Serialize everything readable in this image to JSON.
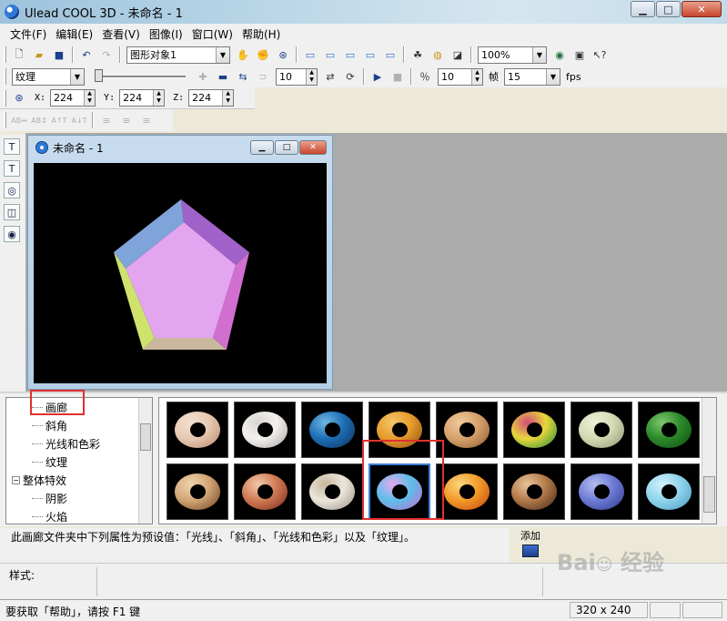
{
  "window": {
    "title": "Ulead COOL 3D - 未命名 - 1"
  },
  "menu": [
    "文件(F)",
    "编辑(E)",
    "查看(V)",
    "图像(I)",
    "窗口(W)",
    "帮助(H)"
  ],
  "toolbar1": {
    "object_combo": "图形对象1",
    "zoom_combo": "100%"
  },
  "toolbar2": {
    "attr_combo": "纹理",
    "spin1": "10",
    "spin2": "10",
    "fps_combo": "15",
    "frame_label": "帧",
    "fps_label": "fps"
  },
  "toolbar3": {
    "x_label": "X:",
    "x_value": "224",
    "y_label": "Y:",
    "y_value": "224",
    "z_label": "Z:",
    "z_value": "224"
  },
  "toolbar4": {
    "icons": [
      "AB↔",
      "AB↕",
      "A↑T",
      "A↓T"
    ]
  },
  "document": {
    "title": "未命名 - 1"
  },
  "pentagon": {
    "face_color": "#e3a4f0",
    "edge_colors": [
      "#7fa4d9",
      "#a062c8",
      "#d06fd0",
      "#c9b89f",
      "#cfe26c"
    ]
  },
  "tree": {
    "items": [
      {
        "label": "画廊",
        "level": 2,
        "highlighted": true
      },
      {
        "label": "斜角",
        "level": 2
      },
      {
        "label": "光线和色彩",
        "level": 2
      },
      {
        "label": "纹理",
        "level": 2
      },
      {
        "label": "整体特效",
        "level": 1,
        "expander": "−"
      },
      {
        "label": "阴影",
        "level": 2
      },
      {
        "label": "火焰",
        "level": 2
      }
    ]
  },
  "gallery": {
    "selected_index": 11,
    "rings": [
      {
        "colors": [
          "#e8c9b2",
          "#b7886c",
          "#f2e1d0"
        ]
      },
      {
        "colors": [
          "#f3f1ee",
          "#a7a39f",
          "#d9d6d2"
        ]
      },
      {
        "colors": [
          "#1d6fb5",
          "#0e2f59",
          "#6fb8e5"
        ]
      },
      {
        "colors": [
          "#e79c2c",
          "#8a4a10",
          "#f5c56b"
        ]
      },
      {
        "colors": [
          "#d7a26c",
          "#8c5b31",
          "#efc99b"
        ]
      },
      {
        "colors": [
          "#e9d63a",
          "#1b8a3b",
          "#d14b7c"
        ]
      },
      {
        "colors": [
          "#d5dab4",
          "#8a9472",
          "#eef0d9"
        ]
      },
      {
        "colors": [
          "#2c8a2a",
          "#0f4a12",
          "#7cc76c"
        ]
      },
      {
        "colors": [
          "#d3a676",
          "#6e3f1d",
          "#f0d4ad"
        ]
      },
      {
        "colors": [
          "#d17a55",
          "#7a2a1a",
          "#f0c8a8"
        ]
      },
      {
        "colors": [
          "#ebe6dc",
          "#9b9080",
          "#c7b79a"
        ]
      },
      {
        "colors": [
          "#5bbfe8",
          "#c46ad0",
          "#e6a9f0"
        ]
      },
      {
        "colors": [
          "#f39b2a",
          "#c4430f",
          "#f9d77c"
        ]
      },
      {
        "colors": [
          "#b47b4b",
          "#3e2414",
          "#e8c39a"
        ]
      },
      {
        "colors": [
          "#6f7cd6",
          "#2e378a",
          "#b6bdf0"
        ]
      },
      {
        "colors": [
          "#8fd4ec",
          "#4b9cc2",
          "#d2f0fa"
        ]
      }
    ]
  },
  "description": "此画廊文件夹中下列属性为预设值：「光线」、「斜角」、「光线和色彩」以及「纹理」。",
  "add_label": "添加",
  "style_label": "样式:",
  "status": {
    "help_text": "要获取「帮助」，请按 F1 键",
    "resolution": "320 x 240"
  },
  "watermark": "Bai 经验"
}
